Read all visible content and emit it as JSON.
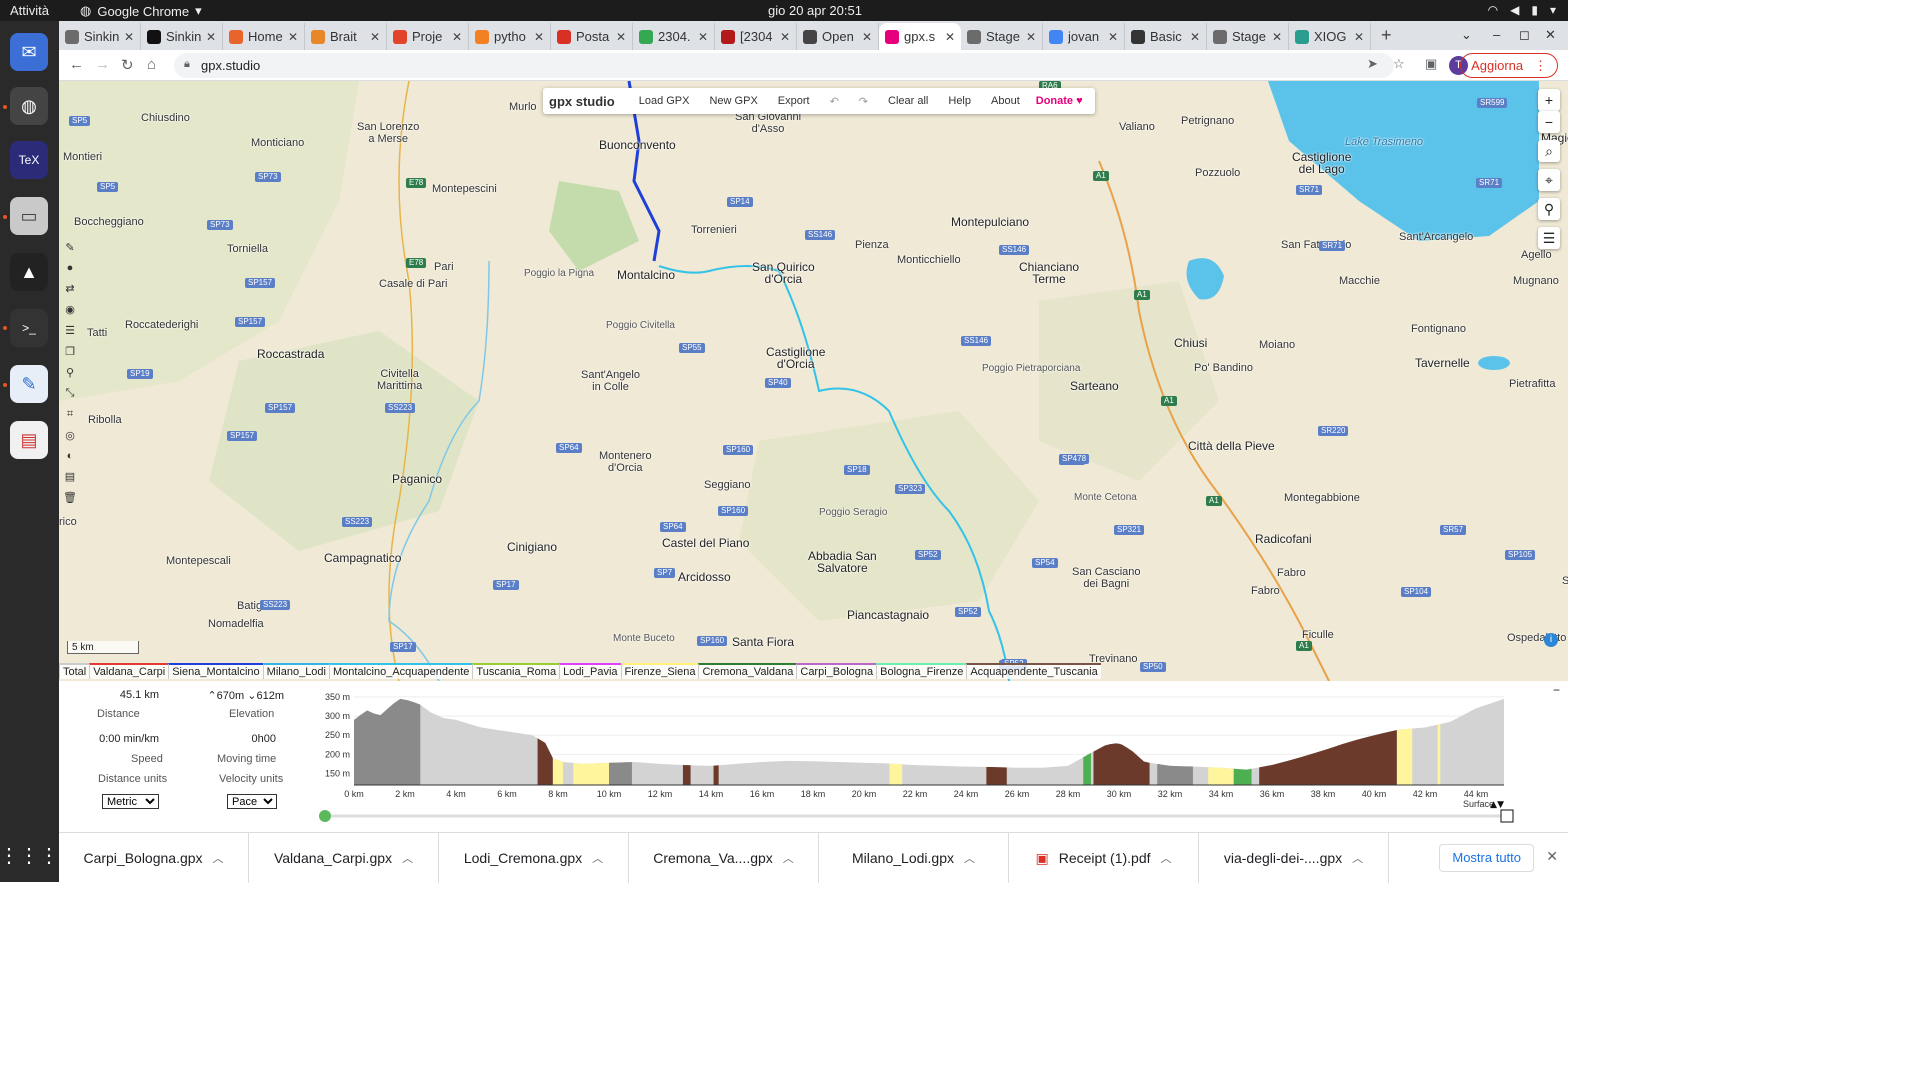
{
  "top_bar": {
    "activities": "Attività",
    "app_name": "Google Chrome",
    "clock": "gio 20 apr  20:51"
  },
  "tabs": [
    {
      "title": "Sinkin",
      "color": "#6b6b6b"
    },
    {
      "title": "Sinkin",
      "color": "#111111"
    },
    {
      "title": "Home",
      "color": "#e8642a"
    },
    {
      "title": "Brait",
      "color": "#e8872a"
    },
    {
      "title": "Proje",
      "color": "#e24329"
    },
    {
      "title": "pytho",
      "color": "#f48024"
    },
    {
      "title": "Posta",
      "color": "#d93025"
    },
    {
      "title": "2304.",
      "color": "#34a853"
    },
    {
      "title": "[2304",
      "color": "#b31b1b"
    },
    {
      "title": "Open",
      "color": "#444444"
    },
    {
      "title": "gpx.s",
      "color": "#e6007e"
    },
    {
      "title": "Stage",
      "color": "#6b6b6b"
    },
    {
      "title": "jovan",
      "color": "#4285f4"
    },
    {
      "title": "Basic",
      "color": "#333333"
    },
    {
      "title": "Stage",
      "color": "#6b6b6b"
    },
    {
      "title": "XIOG",
      "color": "#2a9d8f"
    }
  ],
  "browser": {
    "url": "gpx.studio",
    "update_label": "Aggiorna",
    "profile_initial": "T"
  },
  "app_menu": {
    "logo": "gpx studio",
    "items": [
      "Load GPX",
      "New GPX",
      "Export",
      "Clear all",
      "Help",
      "About"
    ],
    "donate": "Donate"
  },
  "map": {
    "scale": "5 km",
    "places": [
      {
        "text": "Murlo",
        "cls": ""
      },
      {
        "text": "Buonconvento",
        "cls": "big"
      },
      {
        "text": "San Giovanni\nd'Asso",
        "cls": ""
      },
      {
        "text": "Chiusdino",
        "cls": ""
      },
      {
        "text": "Monticiano",
        "cls": ""
      },
      {
        "text": "San Lorenzo\na Merse",
        "cls": ""
      },
      {
        "text": "Montieri",
        "cls": ""
      },
      {
        "text": "Montepescini",
        "cls": ""
      },
      {
        "text": "Torrenieri",
        "cls": ""
      },
      {
        "text": "Boccheggiano",
        "cls": ""
      },
      {
        "text": "Torniella",
        "cls": ""
      },
      {
        "text": "Pari",
        "cls": ""
      },
      {
        "text": "Casale di Pari",
        "cls": ""
      },
      {
        "text": "Poggio la Pigna",
        "cls": "peak"
      },
      {
        "text": "Montalcino",
        "cls": "big"
      },
      {
        "text": "San Quirico\nd'Orcia",
        "cls": "big"
      },
      {
        "text": "Pienza",
        "cls": ""
      },
      {
        "text": "Monticchiello",
        "cls": ""
      },
      {
        "text": "Montepulciano",
        "cls": "big"
      },
      {
        "text": "Chianciano\nTerme",
        "cls": "big"
      },
      {
        "text": "Valiano",
        "cls": ""
      },
      {
        "text": "Petrignano",
        "cls": ""
      },
      {
        "text": "Pozzuolo",
        "cls": ""
      },
      {
        "text": "Castiglione\ndel Lago",
        "cls": "big"
      },
      {
        "text": "Magione",
        "cls": "big"
      },
      {
        "text": "Lake Trasimeno",
        "cls": "water"
      },
      {
        "text": "San Fatucchio",
        "cls": ""
      },
      {
        "text": "Sant'Arcangelo",
        "cls": ""
      },
      {
        "text": "Agello",
        "cls": ""
      },
      {
        "text": "Macchie",
        "cls": ""
      },
      {
        "text": "Mugnano",
        "cls": ""
      },
      {
        "text": "Roccatederighi",
        "cls": ""
      },
      {
        "text": "Roccastrada",
        "cls": "big"
      },
      {
        "text": "Tatti",
        "cls": ""
      },
      {
        "text": "Poggio Civitella",
        "cls": "peak"
      },
      {
        "text": "Castiglione\nd'Orcia",
        "cls": "big"
      },
      {
        "text": "Poggio Pietraporciana",
        "cls": "peak"
      },
      {
        "text": "Chiusi",
        "cls": "big"
      },
      {
        "text": "Moiano",
        "cls": ""
      },
      {
        "text": "Fontignano",
        "cls": ""
      },
      {
        "text": "Tavernelle",
        "cls": "big"
      },
      {
        "text": "Pietrafitta",
        "cls": ""
      },
      {
        "text": "Civitella\nMarittima",
        "cls": ""
      },
      {
        "text": "Sant'Angelo\nin Colle",
        "cls": ""
      },
      {
        "text": "Sarteano",
        "cls": "big"
      },
      {
        "text": "Po' Bandino",
        "cls": ""
      },
      {
        "text": "Ribolla",
        "cls": ""
      },
      {
        "text": "Città della Pieve",
        "cls": "big"
      },
      {
        "text": "Montenero\nd'Orcia",
        "cls": ""
      },
      {
        "text": "Paganico",
        "cls": "big"
      },
      {
        "text": "Seggiano",
        "cls": ""
      },
      {
        "text": "Monte Cetona",
        "cls": "peak"
      },
      {
        "text": "Montegabbione",
        "cls": ""
      },
      {
        "text": "rico",
        "cls": ""
      },
      {
        "text": "Poggio Seragio",
        "cls": "peak"
      },
      {
        "text": "Cinigiano",
        "cls": "big"
      },
      {
        "text": "Castel del Piano",
        "cls": "big"
      },
      {
        "text": "Radicofani",
        "cls": "big"
      },
      {
        "text": "Abbadia San\nSalvatore",
        "cls": "big"
      },
      {
        "text": "Campagnatico",
        "cls": "big"
      },
      {
        "text": "Montepescali",
        "cls": ""
      },
      {
        "text": "Arcidosso",
        "cls": "big"
      },
      {
        "text": "San Casciano\ndei Bagni",
        "cls": ""
      },
      {
        "text": "Fabro",
        "cls": ""
      },
      {
        "text": "Batignano",
        "cls": ""
      },
      {
        "text": "Fabro",
        "cls": ""
      },
      {
        "text": "San V",
        "cls": ""
      },
      {
        "text": "Piancastagnaio",
        "cls": "big"
      },
      {
        "text": "Nomadelfia",
        "cls": ""
      },
      {
        "text": "Monte Buceto",
        "cls": "peak"
      },
      {
        "text": "Santa Fiora",
        "cls": "big"
      },
      {
        "text": "Ficulle",
        "cls": ""
      },
      {
        "text": "Ospedaletto",
        "cls": ""
      },
      {
        "text": "Trevinano",
        "cls": ""
      }
    ],
    "shields": [
      "SP5",
      "SP73",
      "E78",
      "SP5",
      "SP73",
      "E78",
      "SP157",
      "SP157",
      "SP19",
      "SP157",
      "SP157",
      "SS223",
      "SP64",
      "SS223",
      "SP17",
      "SP17",
      "SS223",
      "SP14",
      "SS146",
      "SS146",
      "A1",
      "A1",
      "SR71",
      "SR71",
      "SR71",
      "SR599",
      "RA6",
      "SP55",
      "SS146",
      "SP40",
      "SP323",
      "SP52",
      "SP160",
      "SP18",
      "SP160",
      "SP64",
      "SP7",
      "SP160",
      "SP478",
      "SR220",
      "A1",
      "A1",
      "SP321",
      "SP54",
      "SP52",
      "SP52",
      "SP52",
      "SR57",
      "SP105",
      "SP104",
      "SP50",
      "A1",
      "SP52"
    ],
    "trace_tabs": [
      {
        "label": "Total",
        "color": "#cccccc"
      },
      {
        "label": "Valdana_Carpi",
        "color": "#e53935"
      },
      {
        "label": "Siena_Montalcino",
        "color": "#1e40d8"
      },
      {
        "label": "Milano_Lodi",
        "color": "#33b5e5"
      },
      {
        "label": "Montalcino_Acquapendente",
        "color": "#33c3e8"
      },
      {
        "label": "Tuscania_Roma",
        "color": "#9acd32"
      },
      {
        "label": "Lodi_Pavia",
        "color": "#e040fb"
      },
      {
        "label": "Firenze_Siena",
        "color": "#fff176"
      },
      {
        "label": "Cremona_Valdana",
        "color": "#2e7d32"
      },
      {
        "label": "Carpi_Bologna",
        "color": "#ba68c8"
      },
      {
        "label": "Bologna_Firenze",
        "color": "#69f0ae"
      },
      {
        "label": "Acquapendente_Tuscania",
        "color": "#795548"
      }
    ]
  },
  "stats": {
    "distance_value": "45.1 km",
    "distance_label": "Distance",
    "elev_up": "670m",
    "elev_down": "612m",
    "elevation_label": "Elevation",
    "speed_value": "0:00 min/km",
    "speed_label": "Speed",
    "moving_value": "0h00",
    "moving_label": "Moving time",
    "dist_units_label": "Distance units",
    "vel_units_label": "Velocity units",
    "dist_units_value": "Metric",
    "vel_units_value": "Pace"
  },
  "chart_data": {
    "type": "area",
    "title": "",
    "xlabel": "",
    "ylabel": "",
    "x_ticks": [
      "0 km",
      "2 km",
      "4 km",
      "6 km",
      "8 km",
      "10 km",
      "12 km",
      "14 km",
      "16 km",
      "18 km",
      "20 km",
      "22 km",
      "24 km",
      "26 km",
      "28 km",
      "30 km",
      "32 km",
      "34 km",
      "36 km",
      "38 km",
      "40 km",
      "42 km",
      "44 km"
    ],
    "y_ticks": [
      "350 m",
      "300 m",
      "250 m",
      "200 m",
      "150 m"
    ],
    "xlim": [
      0,
      45.1
    ],
    "ylim": [
      120,
      355
    ],
    "legend_label": "Surface",
    "x": [
      0,
      0.5,
      1,
      1.5,
      1.8,
      2.2,
      2.6,
      3,
      3.5,
      4,
      4.5,
      5,
      5.5,
      6,
      6.5,
      7,
      7.5,
      7.8,
      8.2,
      9,
      10,
      11,
      12,
      13,
      14,
      15,
      16,
      17,
      18,
      19,
      20,
      21,
      22,
      23,
      24,
      25,
      26,
      27,
      28,
      28.8,
      29.5,
      30,
      30.5,
      31,
      32,
      33,
      34,
      35,
      36,
      37,
      38,
      39,
      40,
      41,
      42,
      43,
      44,
      45.1
    ],
    "y": [
      290,
      315,
      300,
      330,
      345,
      340,
      330,
      310,
      295,
      290,
      280,
      270,
      265,
      260,
      255,
      250,
      230,
      190,
      180,
      175,
      178,
      180,
      175,
      172,
      170,
      175,
      180,
      183,
      182,
      180,
      178,
      176,
      172,
      170,
      168,
      167,
      165,
      165,
      170,
      200,
      225,
      230,
      210,
      180,
      170,
      168,
      165,
      160,
      172,
      190,
      210,
      232,
      250,
      265,
      270,
      285,
      320,
      345
    ],
    "surface_bands": [
      {
        "from": 0,
        "to": 2.6,
        "surface": "gravel"
      },
      {
        "from": 7.2,
        "to": 7.8,
        "surface": "unpaved"
      },
      {
        "from": 7.8,
        "to": 8.2,
        "surface": "sand"
      },
      {
        "from": 8.6,
        "to": 10,
        "surface": "sand"
      },
      {
        "from": 10,
        "to": 10.9,
        "surface": "gravel"
      },
      {
        "from": 12.9,
        "to": 13.2,
        "surface": "unpaved"
      },
      {
        "from": 14.1,
        "to": 14.3,
        "surface": "unpaved"
      },
      {
        "from": 21,
        "to": 21.5,
        "surface": "sand"
      },
      {
        "from": 24.8,
        "to": 25.6,
        "surface": "unpaved"
      },
      {
        "from": 28.6,
        "to": 28.9,
        "surface": "grass"
      },
      {
        "from": 29,
        "to": 31.2,
        "surface": "unpaved"
      },
      {
        "from": 31.5,
        "to": 32.9,
        "surface": "gravel"
      },
      {
        "from": 33.5,
        "to": 34.5,
        "surface": "sand"
      },
      {
        "from": 34.5,
        "to": 35.2,
        "surface": "grass"
      },
      {
        "from": 35.5,
        "to": 40.9,
        "surface": "unpaved"
      },
      {
        "from": 40.9,
        "to": 41.5,
        "surface": "sand"
      },
      {
        "from": 42.5,
        "to": 42.6,
        "surface": "sand"
      }
    ],
    "surface_colors": {
      "gravel": "#8a8a8a",
      "unpaved": "#6b3a2a",
      "sand": "#fff59d",
      "grass": "#4caf50",
      "default": "#d3d3d3"
    }
  },
  "downloads": [
    {
      "name": "Carpi_Bologna.gpx",
      "icon": ""
    },
    {
      "name": "Valdana_Carpi.gpx",
      "icon": ""
    },
    {
      "name": "Lodi_Cremona.gpx",
      "icon": ""
    },
    {
      "name": "Cremona_Va....gpx",
      "icon": ""
    },
    {
      "name": "Milano_Lodi.gpx",
      "icon": ""
    },
    {
      "name": "Receipt (1).pdf",
      "icon": "pdf-icon"
    },
    {
      "name": "via-degli-dei-....gpx",
      "icon": ""
    }
  ],
  "downloads_show_all": "Mostra tutto"
}
